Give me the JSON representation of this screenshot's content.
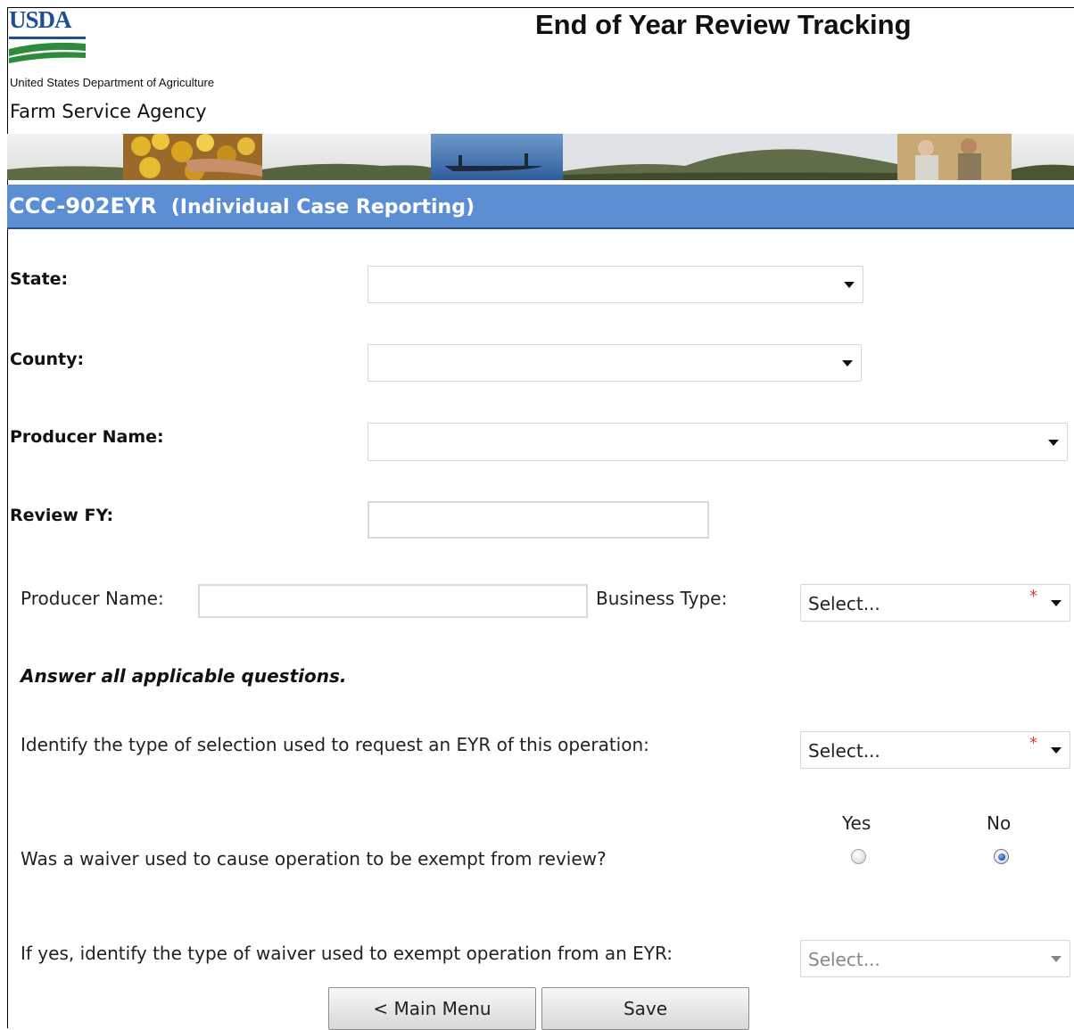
{
  "header": {
    "logo_text": "USDA",
    "app_title": "End of Year Review Tracking",
    "department": "United States Department of Agriculture",
    "agency": "Farm Service Agency"
  },
  "form": {
    "title": "CCC-902EYR",
    "subtitle": "(Individual Case Reporting)",
    "state_label": "State:",
    "state_value": "",
    "county_label": "County:",
    "county_value": "",
    "producer_name_label": "Producer Name:",
    "producer_name_value": "",
    "review_fy_label": "Review FY:",
    "review_fy_value": "",
    "detail_producer_name_label": "Producer Name:",
    "detail_producer_name_value": "",
    "business_type_label": "Business Type:",
    "business_type_value": "Select...",
    "required_marker": "*",
    "instructions": "Answer all applicable questions.",
    "selection_type_question": "Identify the type of selection used to request an EYR of this operation:",
    "selection_type_value": "Select...",
    "waiver_question": "Was a waiver used to cause operation to be exempt from review?",
    "yes_label": "Yes",
    "no_label": "No",
    "waiver_answer": "No",
    "waiver_type_question": "If yes, identify the type of waiver used to exempt operation from an EYR:",
    "waiver_type_value": "Select..."
  },
  "buttons": {
    "main_menu": "< Main Menu",
    "save": "Save"
  },
  "colors": {
    "form_bar": "#5b8ed3",
    "logo_blue": "#1d4f91",
    "logo_green": "#2e8a3c",
    "required": "#e23b3b"
  }
}
